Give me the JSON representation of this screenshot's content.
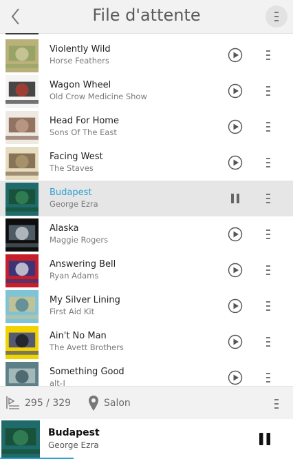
{
  "header": {
    "title": "File d'attente",
    "back_icon": "chevron-left-icon",
    "menu_icon": "kebab-icon"
  },
  "queue": [
    {
      "title": "Violently Wild",
      "artist": "Horse Feathers",
      "state": "paused",
      "cover_colors": [
        "#b9b07a",
        "#8da160",
        "#d8cfa8"
      ]
    },
    {
      "title": "Wagon Wheel",
      "artist": "Old Crow Medicine Show",
      "state": "paused",
      "cover_colors": [
        "#f4f4f4",
        "#1a1a1a",
        "#c23b2b"
      ]
    },
    {
      "title": "Head For Home",
      "artist": "Sons Of The East",
      "state": "paused",
      "cover_colors": [
        "#eeeae3",
        "#7a5440",
        "#c7a48e"
      ]
    },
    {
      "title": "Facing West",
      "artist": "The Staves",
      "state": "paused",
      "cover_colors": [
        "#e7dcc0",
        "#6f5a3c",
        "#b59e72"
      ]
    },
    {
      "title": "Budapest",
      "artist": "George Ezra",
      "state": "playing",
      "cover_colors": [
        "#1f6a6a",
        "#184c2f",
        "#3a8f5c"
      ]
    },
    {
      "title": "Alaska",
      "artist": "Maggie Rogers",
      "state": "paused",
      "cover_colors": [
        "#0e0e0e",
        "#5f6e7a",
        "#d9dde0"
      ]
    },
    {
      "title": "Answering Bell",
      "artist": "Ryan Adams",
      "state": "paused",
      "cover_colors": [
        "#c61f2b",
        "#1a3a8c",
        "#f0f0f0"
      ]
    },
    {
      "title": "My Silver Lining",
      "artist": "First Aid Kit",
      "state": "paused",
      "cover_colors": [
        "#7fc3d6",
        "#d0c28a",
        "#3e7c95"
      ]
    },
    {
      "title": "Ain't No Man",
      "artist": "The Avett Brothers",
      "state": "paused",
      "cover_colors": [
        "#f2d200",
        "#2b3c8d",
        "#111111"
      ]
    },
    {
      "title": "Something Good",
      "artist": "alt-J",
      "state": "paused",
      "cover_colors": [
        "#5d7f86",
        "#b4c7c6",
        "#2c4a52"
      ]
    }
  ],
  "footer": {
    "queue_position": "295 / 329",
    "room": "Salon",
    "queue_icon": "queue-list-icon",
    "room_icon": "location-pin-icon"
  },
  "now_playing": {
    "title": "Budapest",
    "artist": "George Ezra",
    "progress": 0.25,
    "cover_colors": [
      "#1f6a6a",
      "#184c2f",
      "#3a8f5c"
    ]
  },
  "colors": {
    "accent": "#2fa0cf",
    "header_bg": "#f2f2f2",
    "active_row_bg": "#e6e6e6"
  }
}
